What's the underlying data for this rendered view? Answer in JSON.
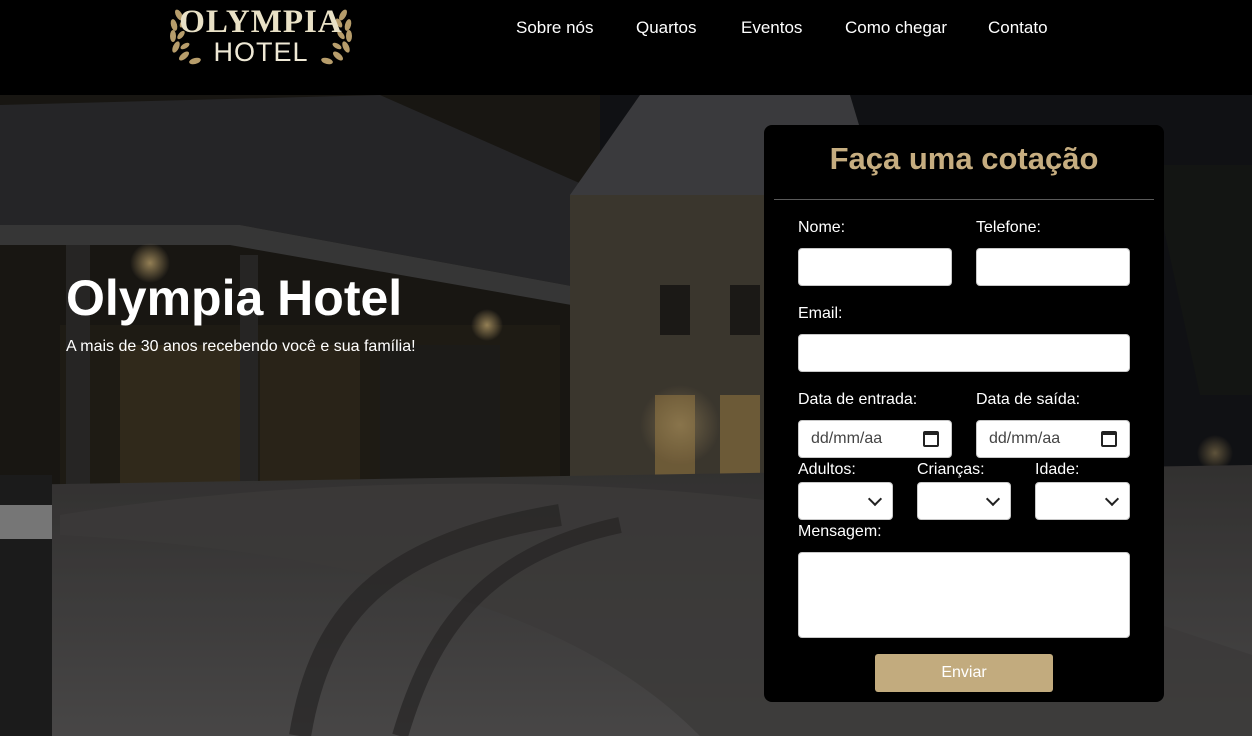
{
  "header": {
    "logo": {
      "line1": "OLYMPIA",
      "line2": "HOTEL"
    },
    "nav": [
      "Sobre nós",
      "Quartos",
      "Eventos",
      "Como chegar",
      "Contato"
    ]
  },
  "hero": {
    "title": "Olympia Hotel",
    "subtitle": "A mais de 30 anos recebendo você e sua família!"
  },
  "form": {
    "title": "Faça uma cotação",
    "labels": {
      "name": "Nome:",
      "phone": "Telefone:",
      "email": "Email:",
      "checkin": "Data de entrada:",
      "checkout": "Data de saída:",
      "adults": "Adultos:",
      "children": "Crianças:",
      "age": "Idade:",
      "message": "Mensagem:"
    },
    "date_placeholder": "dd/mm/aa",
    "submit": "Enviar"
  },
  "colors": {
    "accent": "#c2ab7e",
    "title": "#c6ad80",
    "header_bg": "#000000"
  },
  "icons": {
    "calendar": "calendar-icon",
    "select": "chevron-down-icon"
  }
}
